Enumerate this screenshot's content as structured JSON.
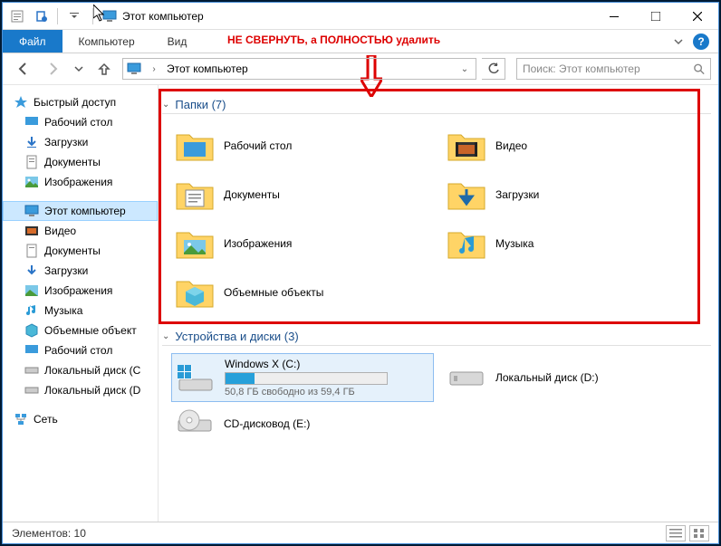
{
  "window": {
    "title": "Этот компьютер"
  },
  "ribbon": {
    "file": "Файл",
    "tab1": "Компьютер",
    "tab2": "Вид"
  },
  "annotation": "НЕ СВЕРНУТЬ, а ПОЛНОСТЬЮ удалить",
  "address": {
    "path": "Этот компьютер"
  },
  "search": {
    "placeholder": "Поиск: Этот компьютер"
  },
  "sidebar": {
    "quick": "Быстрый доступ",
    "quick_items": {
      "desktop": "Рабочий стол",
      "downloads": "Загрузки",
      "documents": "Документы",
      "pictures": "Изображения"
    },
    "thispc": "Этот компьютер",
    "pc_items": {
      "videos": "Видео",
      "documents": "Документы",
      "downloads": "Загрузки",
      "pictures": "Изображения",
      "music": "Музыка",
      "objects3d": "Объемные объект",
      "desktop": "Рабочий стол",
      "diskc": "Локальный диск (C",
      "diskd": "Локальный диск (D"
    },
    "network": "Сеть"
  },
  "groups": {
    "folders": "Папки (7)",
    "drives": "Устройства и диски (3)"
  },
  "folders": {
    "desktop": "Рабочий стол",
    "videos": "Видео",
    "documents": "Документы",
    "downloads": "Загрузки",
    "pictures": "Изображения",
    "music": "Музыка",
    "objects3d": "Объемные объекты"
  },
  "drives": {
    "c": {
      "name": "Windows X (C:)",
      "sub": "50,8 ГБ свободно из 59,4 ГБ",
      "fillpct": 18
    },
    "d": {
      "name": "Локальный диск (D:)"
    },
    "e": {
      "name": "CD-дисковод (E:)"
    }
  },
  "status": {
    "count": "Элементов: 10"
  }
}
